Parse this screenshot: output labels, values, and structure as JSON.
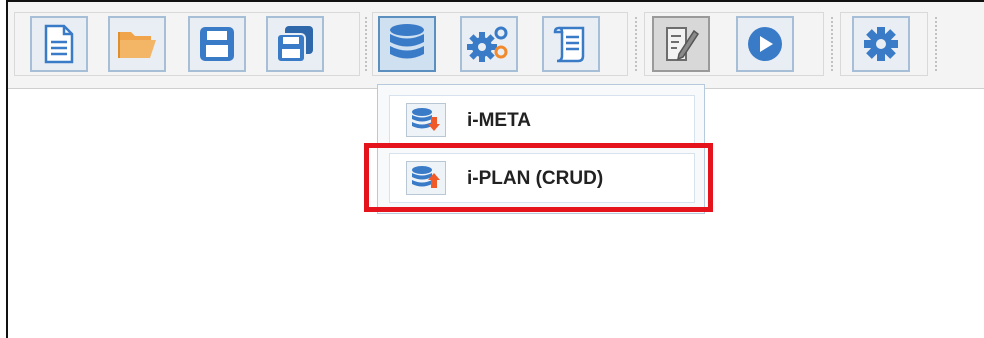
{
  "toolbar": {
    "buttons": [
      {
        "icon": "new-document-icon"
      },
      {
        "icon": "open-folder-icon"
      },
      {
        "icon": "save-icon"
      },
      {
        "icon": "save-all-icon"
      },
      {
        "icon": "database-icon"
      },
      {
        "icon": "gears-icon"
      },
      {
        "icon": "script-scroll-icon"
      },
      {
        "icon": "edit-icon"
      },
      {
        "icon": "play-icon"
      },
      {
        "icon": "settings-icon"
      }
    ]
  },
  "dropdown": {
    "items": [
      {
        "label": "i-META",
        "icon": "db-import-icon"
      },
      {
        "label": "i-PLAN (CRUD)",
        "icon": "db-export-icon"
      }
    ]
  },
  "colors": {
    "icon_blue": "#3a7bc8",
    "folder_orange": "#f0a44b",
    "highlight_red": "#e5131c",
    "gear_orange": "#f08a2c"
  }
}
